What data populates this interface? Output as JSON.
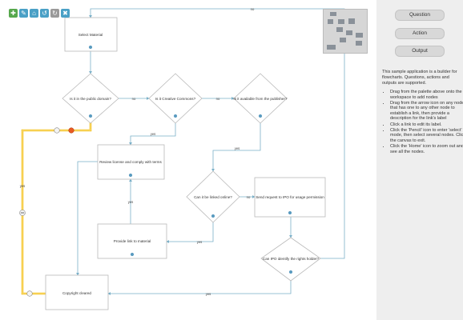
{
  "toolbar": [
    {
      "name": "add-icon",
      "glyph": "✚",
      "color": "#57a84d"
    },
    {
      "name": "pencil-icon",
      "glyph": "✎",
      "color": "#4aa0c6"
    },
    {
      "name": "home-icon",
      "glyph": "⌂",
      "color": "#4aa0c6"
    },
    {
      "name": "undo-icon",
      "glyph": "↺",
      "color": "#4aa0c6"
    },
    {
      "name": "redo-icon",
      "glyph": "↻",
      "color": "#9a9a9a"
    },
    {
      "name": "close-icon",
      "glyph": "✖",
      "color": "#4aa0c6"
    }
  ],
  "colors": {
    "edge": "#7ab0c8",
    "highlight": "#f5c425",
    "node_border": "#b9b9b9",
    "badge": "#5a9bc0"
  },
  "nodes": {
    "select": "Select Material",
    "public": "Is it in the public domain?",
    "cc": "Is it Creative Commons?",
    "publisher": "Is it available from the publisher?",
    "review": "Review license and comply with terms",
    "linked": "Can it be linked online?",
    "ipo_send": "Send request to IPO for usage permission",
    "provide": "Provide link to material",
    "ipo_rights": "Can IPO identify the rights holder?",
    "cleared": "Copyright cleared"
  },
  "edge_labels": {
    "top_no": "no",
    "no": "no",
    "yes": "yes"
  },
  "palette": {
    "question": "Question",
    "action": "Action",
    "output": "Output"
  },
  "description": "This sample application is a builder for flowcharts. Questions, actions and outputs are supported.",
  "help": [
    "Drag from the palette above onto the workspace to add nodes",
    "Drag from the arrow icon on any node that has one to any other node to establish a link, then provide a description for the link's label",
    "Click a link to edit its label.",
    "Click the 'Pencil' icon to enter 'select' mode, then select several nodes. Click the canvas to exit.",
    "Click the 'Home' icon to zoom out and see all the nodes."
  ]
}
